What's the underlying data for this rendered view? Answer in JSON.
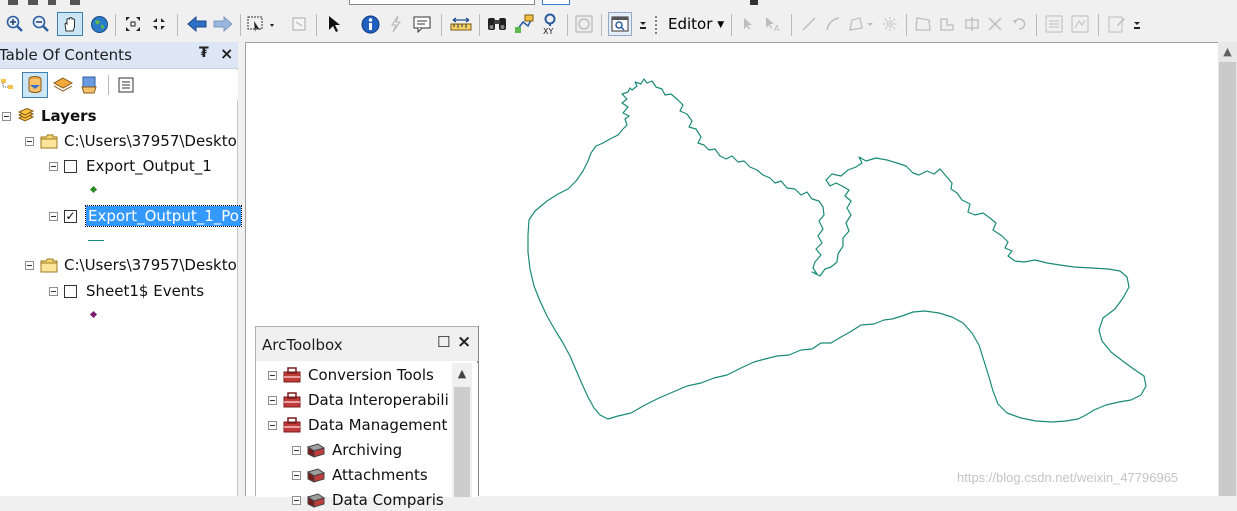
{
  "toolbar": {
    "editor_label": "Editor",
    "icons": [
      "zoom-in-icon",
      "zoom-out-icon",
      "pan-icon",
      "full-extent-icon",
      "fixed-zoom-in-icon",
      "fixed-zoom-out-icon",
      "back-icon",
      "forward-icon",
      "select-features-icon",
      "clear-selection-icon",
      "select-elements-icon",
      "identify-icon",
      "hyperlink-icon",
      "html-popup-icon",
      "measure-icon",
      "find-icon",
      "find-route-icon",
      "go-to-xy-icon",
      "time-slider-icon",
      "viewer-window-icon"
    ]
  },
  "toc": {
    "title": "Table Of Contents",
    "pin_symbol": "₮",
    "close_symbol": "×",
    "layers_label": "Layers",
    "items": [
      {
        "label": "C:\\Users\\37957\\Deskto"
      },
      {
        "label": "Export_Output_1",
        "checked": false
      },
      {
        "label": "Export_Output_1_Po",
        "checked": true,
        "selected": true
      },
      {
        "label": "C:\\Users\\37957\\Deskto"
      },
      {
        "label": "Sheet1$ Events",
        "checked": false
      }
    ],
    "check_mark": "✓"
  },
  "toolbox": {
    "title": "ArcToolbox",
    "max_symbol": "☐",
    "close_symbol": "×",
    "items": [
      {
        "label": "Conversion Tools"
      },
      {
        "label": "Data Interoperabili"
      },
      {
        "label": "Data Management"
      },
      {
        "label": "Archiving"
      },
      {
        "label": "Attachments"
      },
      {
        "label": "Data Comparis"
      }
    ]
  },
  "map": {
    "boundary_color": "#1a8a78"
  },
  "watermark": "https://blog.csdn.net/weixin_47796965"
}
